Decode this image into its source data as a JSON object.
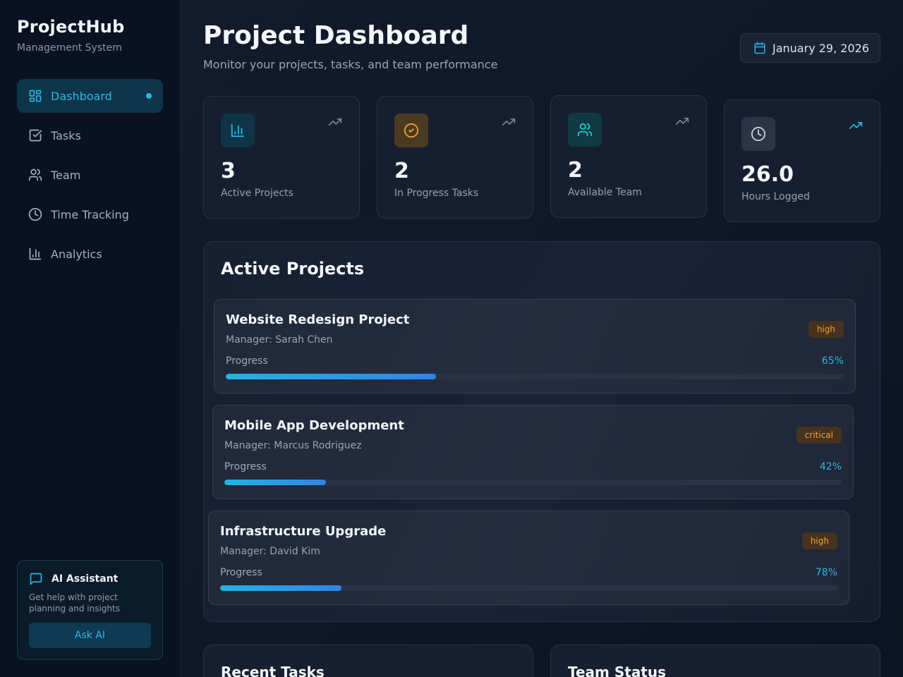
{
  "sidebar": {
    "brand_title": "ProjectHub",
    "brand_subtitle": "Management System",
    "items": [
      {
        "label": "Dashboard",
        "icon": "dashboard-icon",
        "active": true
      },
      {
        "label": "Tasks",
        "icon": "checkbox-icon"
      },
      {
        "label": "Team",
        "icon": "users-icon"
      },
      {
        "label": "Time Tracking",
        "icon": "clock-icon"
      },
      {
        "label": "Analytics",
        "icon": "chart-icon"
      }
    ],
    "ai": {
      "title": "AI Assistant",
      "description": "Get help with project planning and insights",
      "button": "Ask AI"
    }
  },
  "header": {
    "title": "Project Dashboard",
    "subtitle": "Monitor your projects, tasks, and team performance",
    "date": "January 29, 2026"
  },
  "stats": [
    {
      "value": "3",
      "label": "Active Projects",
      "icon": "bar-chart-icon",
      "color": "#22b8e8"
    },
    {
      "value": "2",
      "label": "In Progress Tasks",
      "icon": "check-circle-icon",
      "color": "#e8a23a"
    },
    {
      "value": "2",
      "label": "Available Team",
      "icon": "users-icon",
      "color": "#2ac6cf"
    },
    {
      "value": "26.0",
      "label": "Hours Logged",
      "icon": "clock-icon",
      "color": "#c6cdd9"
    }
  ],
  "projects": {
    "title": "Active Projects",
    "progress_label": "Progress",
    "items": [
      {
        "name": "Website Redesign Project",
        "manager": "Manager: Sarah Chen",
        "priority": "high",
        "progress_text": "65%",
        "progress": 0.34
      },
      {
        "name": "Mobile App Development",
        "manager": "Manager: Marcus Rodriguez",
        "priority": "critical",
        "progress_text": "42%",
        "progress": 0.165
      },
      {
        "name": "Infrastructure Upgrade",
        "manager": "Manager: David Kim",
        "priority": "high",
        "progress_text": "78%",
        "progress": 0.197
      }
    ]
  },
  "sections": {
    "recent_tasks": "Recent Tasks",
    "team_status": "Team Status"
  }
}
